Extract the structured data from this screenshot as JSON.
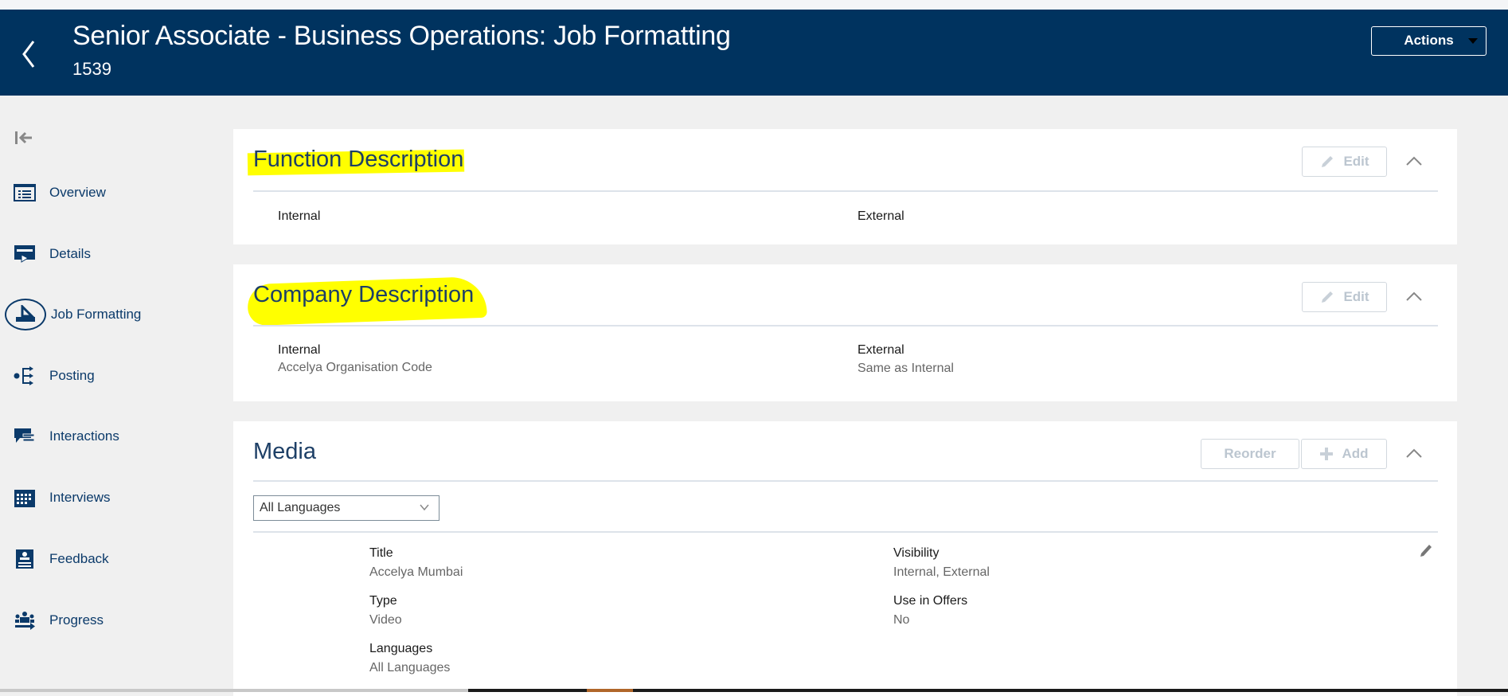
{
  "header": {
    "title": "Senior Associate - Business Operations: Job Formatting",
    "subtitle": "1539",
    "actions_label": "Actions"
  },
  "sidebar": {
    "items": [
      {
        "label": "Overview",
        "icon": "overview-icon"
      },
      {
        "label": "Details",
        "icon": "details-icon"
      },
      {
        "label": "Job Formatting",
        "icon": "job-formatting-icon",
        "active": true
      },
      {
        "label": "Posting",
        "icon": "posting-icon"
      },
      {
        "label": "Interactions",
        "icon": "interactions-icon"
      },
      {
        "label": "Interviews",
        "icon": "calendar-icon"
      },
      {
        "label": "Feedback",
        "icon": "feedback-icon"
      },
      {
        "label": "Progress",
        "icon": "progress-icon"
      }
    ]
  },
  "function_description": {
    "title": "Function Description",
    "edit_label": "Edit",
    "internal_label": "Internal",
    "external_label": "External"
  },
  "company_description": {
    "title": "Company Description",
    "edit_label": "Edit",
    "internal_label": "Internal",
    "internal_value": "Accelya Organisation Code",
    "external_label": "External",
    "external_value": "Same as Internal"
  },
  "media": {
    "title": "Media",
    "reorder_label": "Reorder",
    "add_label": "Add",
    "language_select": "All Languages",
    "item": {
      "title_label": "Title",
      "title_value": "Accelya Mumbai",
      "visibility_label": "Visibility",
      "visibility_value": "Internal, External",
      "type_label": "Type",
      "type_value": "Video",
      "offers_label": "Use in Offers",
      "offers_value": "No",
      "languages_label": "Languages",
      "languages_value": "All Languages"
    }
  },
  "colors": {
    "header": "#00335f",
    "highlight": "#ffff00",
    "nav": "#0b3a6a"
  }
}
